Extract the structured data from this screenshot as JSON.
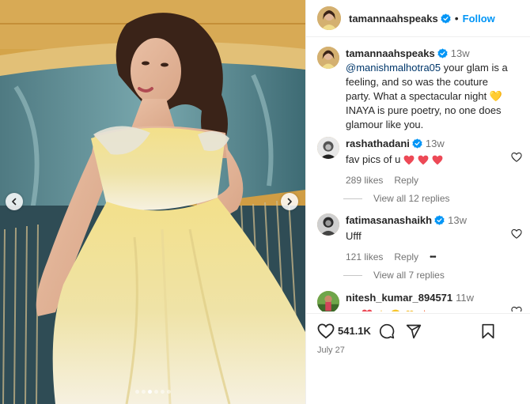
{
  "colors": {
    "accent": "#0095f6",
    "verified": "#0095f6",
    "heart": "#ed4956",
    "text": "#262626",
    "muted": "#737373"
  },
  "post": {
    "author": "tamannaahspeaks",
    "separator": "•",
    "follow_label": "Follow",
    "carousel": {
      "slide_count": 6,
      "active_index": 2
    }
  },
  "caption": {
    "username": "tamannaahspeaks",
    "time": "13w",
    "mention": "@manishmalhotra05",
    "text": " your glam is a feeling, and so was the couture party. What a spectacular night 💛 INAYA is pure poetry, no one does glamour like you."
  },
  "comments": [
    {
      "username": "rashathadani",
      "time": "13w",
      "text": "fav pics of u ",
      "emoji": [
        "heart",
        "heart",
        "heart"
      ],
      "likes": "289 likes",
      "reply_label": "Reply",
      "view_replies": "View all 12 replies"
    },
    {
      "username": "fatimasanashaikh",
      "time": "13w",
      "text": "Ufff",
      "likes": "121 likes",
      "reply_label": "Reply",
      "more": "•••",
      "view_replies": "View all 7 replies"
    },
    {
      "username": "nitesh_kumar_894571",
      "time": "11w",
      "text": "•",
      "emoji": [
        "heart",
        "sparkle",
        "heart-eyes",
        "bouquet",
        "fire"
      ]
    }
  ],
  "actions": {
    "like_count": "541.1K",
    "date": "July 27"
  }
}
